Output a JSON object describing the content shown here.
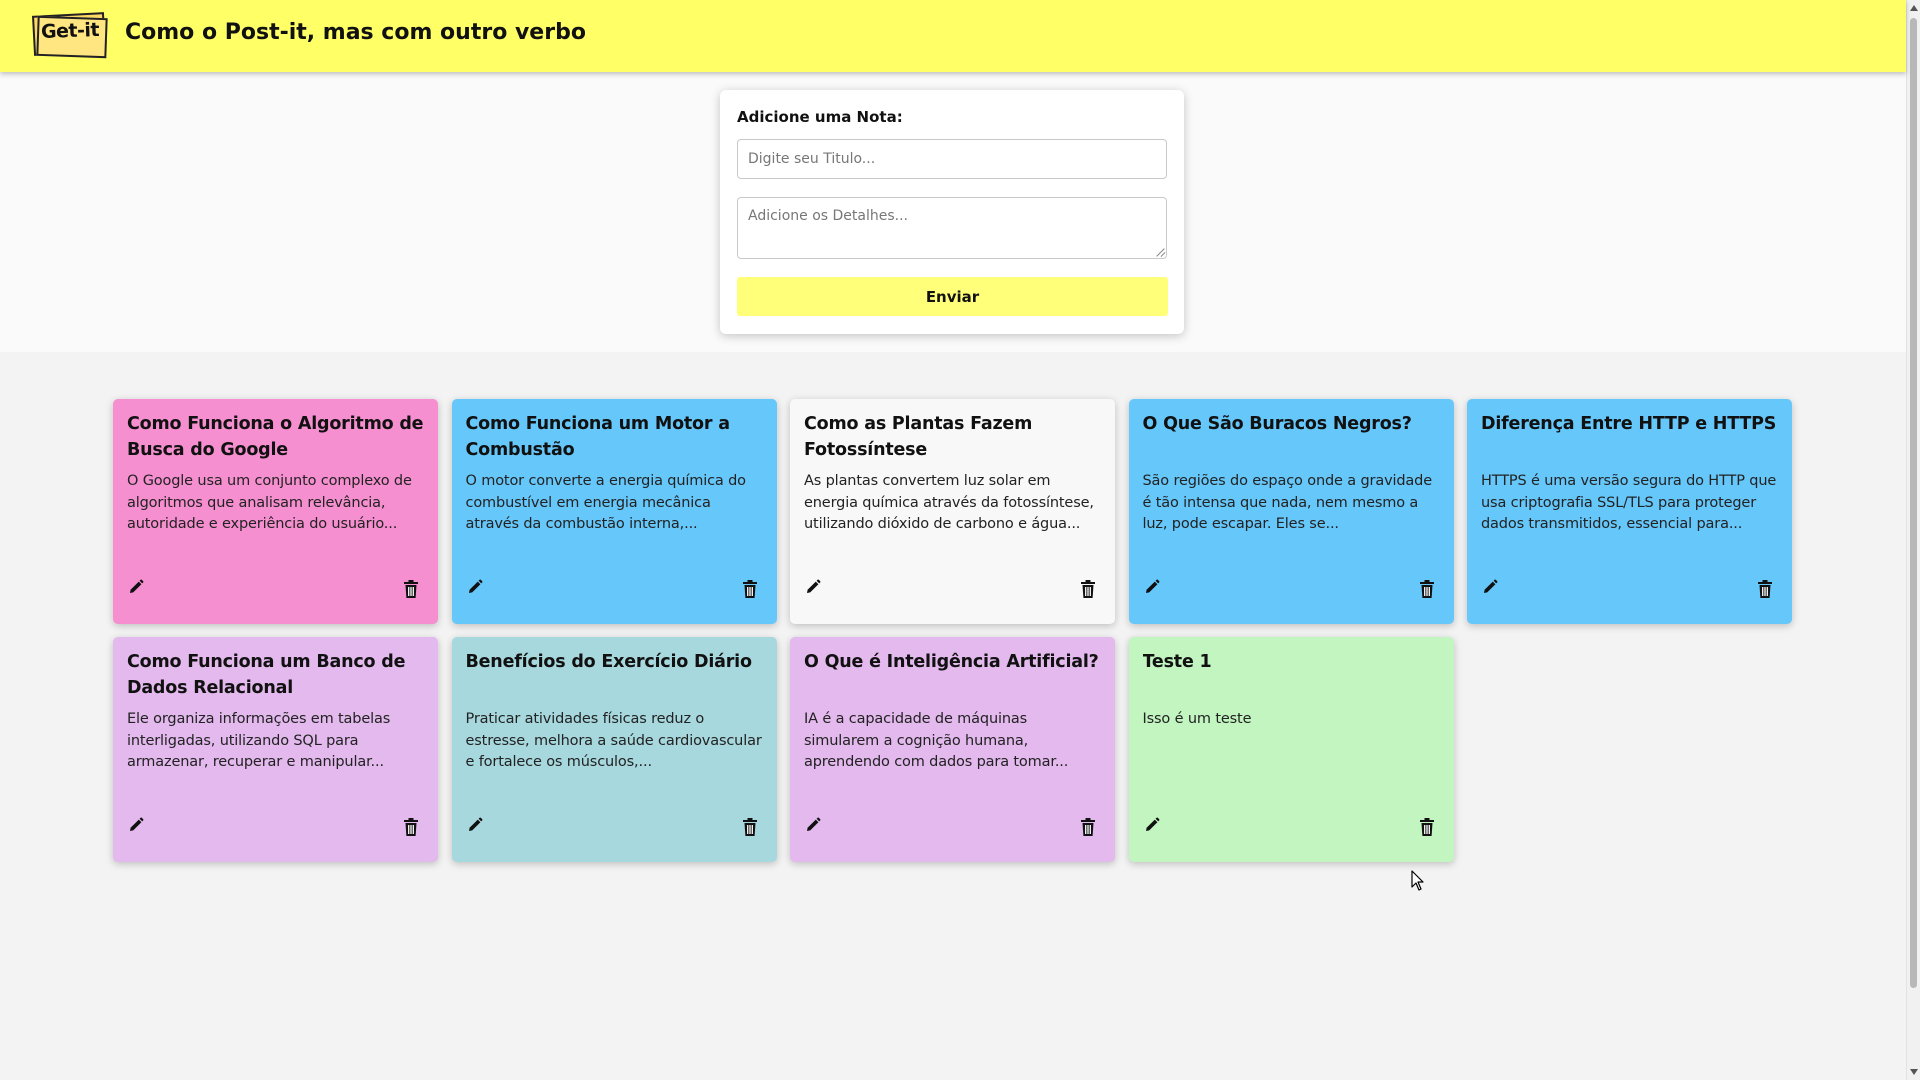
{
  "header": {
    "logo_text": "Get-it",
    "title": "Como o Post-it, mas com outro verbo",
    "background": "#ffff66"
  },
  "form": {
    "label": "Adicione uma Nota:",
    "title_placeholder": "Digite seu Titulo...",
    "title_value": "",
    "details_placeholder": "Adicione os Detalhes...",
    "details_value": "",
    "submit_label": "Enviar",
    "submit_color": "#ffff7a"
  },
  "notes": [
    {
      "title": "Como Funciona o Algoritmo de Busca do Google",
      "body": "O Google usa um conjunto complexo de algoritmos que analisam relevância, autoridade e experiência do usuário...",
      "color": "#f68fd0",
      "edit_icon": "pencil-icon",
      "delete_icon": "trash-icon"
    },
    {
      "title": "Como Funciona um Motor a Combustão",
      "body": "O motor converte a energia química do combustível em energia mecânica através da combustão interna,...",
      "color": "#66c7fa",
      "edit_icon": "pencil-icon",
      "delete_icon": "trash-icon"
    },
    {
      "title": "Como as Plantas Fazem Fotossíntese",
      "body": "As plantas convertem luz solar em energia química através da fotossíntese, utilizando dióxido de carbono e água...",
      "color": "#f8f8f8",
      "edit_icon": "pencil-icon",
      "delete_icon": "trash-icon"
    },
    {
      "title": "O Que São Buracos Negros?",
      "body": "São regiões do espaço onde a gravidade é tão intensa que nada, nem mesmo a luz, pode escapar. Eles se...",
      "color": "#66c7fa",
      "edit_icon": "pencil-icon",
      "delete_icon": "trash-icon"
    },
    {
      "title": "Diferença Entre HTTP e HTTPS",
      "body": "HTTPS é uma versão segura do HTTP que usa criptografia SSL/TLS para proteger dados transmitidos, essencial para...",
      "color": "#66c7fa",
      "edit_icon": "pencil-icon",
      "delete_icon": "trash-icon"
    },
    {
      "title": "Como Funciona um Banco de Dados Relacional",
      "body": "Ele organiza informações em tabelas interligadas, utilizando SQL para armazenar, recuperar e manipular...",
      "color": "#e3b9ee",
      "edit_icon": "pencil-icon",
      "delete_icon": "trash-icon"
    },
    {
      "title": "Benefícios do Exercício Diário",
      "body": "Praticar atividades físicas reduz o estresse, melhora a saúde cardiovascular e fortalece os músculos,...",
      "color": "#a7d8de",
      "edit_icon": "pencil-icon",
      "delete_icon": "trash-icon"
    },
    {
      "title": "O Que é Inteligência Artificial?",
      "body": "IA é a capacidade de máquinas simularem a cognição humana, aprendendo com dados para tomar...",
      "color": "#e3b9ee",
      "edit_icon": "pencil-icon",
      "delete_icon": "trash-icon"
    },
    {
      "title": "Teste 1",
      "body": "Isso é um teste",
      "color": "#c2f5c0",
      "edit_icon": "pencil-icon",
      "delete_icon": "trash-icon"
    }
  ]
}
